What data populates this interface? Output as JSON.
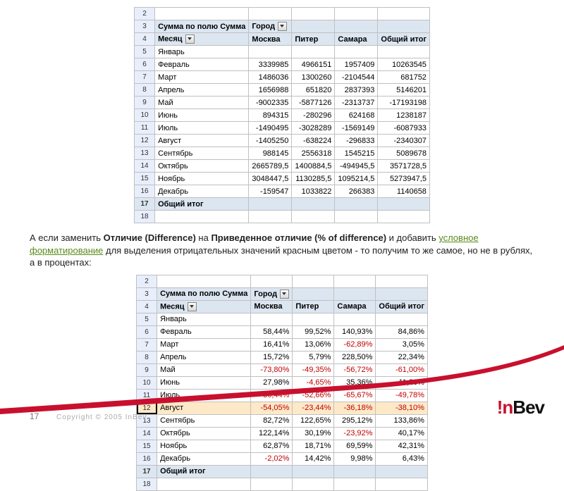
{
  "table1": {
    "pivot_label": "Сумма по полю Сумма",
    "col_group": "Город",
    "row_group": "Месяц",
    "columns": [
      "Москва",
      "Питер",
      "Самара",
      "Общий итог"
    ],
    "row_start_index": 2,
    "row_labels": [
      "Январь",
      "Февраль",
      "Март",
      "Апрель",
      "Май",
      "Июнь",
      "Июль",
      "Август",
      "Сентябрь",
      "Октябрь",
      "Ноябрь",
      "Декабрь"
    ],
    "total_label": "Общий итог",
    "data": [
      [
        "",
        "",
        "",
        ""
      ],
      [
        "3339985",
        "4966151",
        "1957409",
        "10263545"
      ],
      [
        "1486036",
        "1300260",
        "-2104544",
        "681752"
      ],
      [
        "1656988",
        "651820",
        "2837393",
        "5146201"
      ],
      [
        "-9002335",
        "-5877126",
        "-2313737",
        "-17193198"
      ],
      [
        "894315",
        "-280296",
        "624168",
        "1238187"
      ],
      [
        "-1490495",
        "-3028289",
        "-1569149",
        "-6087933"
      ],
      [
        "-1405250",
        "-638224",
        "-296833",
        "-2340307"
      ],
      [
        "988145",
        "2556318",
        "1545215",
        "5089678"
      ],
      [
        "2665789,5",
        "1400884,5",
        "-494945,5",
        "3571728,5"
      ],
      [
        "3048447,5",
        "1130285,5",
        "1095214,5",
        "5273947,5"
      ],
      [
        "-159547",
        "1033822",
        "266383",
        "1140658"
      ]
    ]
  },
  "paragraph": {
    "t1": "А если заменить ",
    "b1": "Отличие (Difference)",
    "t2": " на ",
    "b2": "Приведенное отличие (% of difference)",
    "t3": " и добавить ",
    "link": "условное форматирование",
    "t4": " для выделения отрицательных значений красным цветом - то получим то же самое, но не в рублях, а в процентах:"
  },
  "table2": {
    "pivot_label": "Сумма по полю Сумма",
    "col_group": "Город",
    "row_group": "Месяц",
    "columns": [
      "Москва",
      "Питер",
      "Самара",
      "Общий итог"
    ],
    "row_start_index": 2,
    "row_labels": [
      "Январь",
      "Февраль",
      "Март",
      "Апрель",
      "Май",
      "Июнь",
      "Июль",
      "Август",
      "Сентябрь",
      "Октябрь",
      "Ноябрь",
      "Декабрь"
    ],
    "total_label": "Общий итог",
    "selected_row_index": 7,
    "data": [
      [
        "",
        "",
        "",
        ""
      ],
      [
        "58,44%",
        "99,52%",
        "140,93%",
        "84,86%"
      ],
      [
        "16,41%",
        "13,06%",
        "-62,89%",
        "3,05%"
      ],
      [
        "15,72%",
        "5,79%",
        "228,50%",
        "22,34%"
      ],
      [
        "-73,80%",
        "-49,35%",
        "-56,72%",
        "-61,00%"
      ],
      [
        "27,98%",
        "-4,65%",
        "35,36%",
        "11,26%"
      ],
      [
        "-36,44%",
        "-52,66%",
        "-65,67%",
        "-49,78%"
      ],
      [
        "-54,05%",
        "-23,44%",
        "-36,18%",
        "-38,10%"
      ],
      [
        "82,72%",
        "122,65%",
        "295,12%",
        "133,86%"
      ],
      [
        "122,14%",
        "30,19%",
        "-23,92%",
        "40,17%"
      ],
      [
        "62,87%",
        "18,71%",
        "69,59%",
        "42,31%"
      ],
      [
        "-2,02%",
        "14,42%",
        "9,98%",
        "6,43%"
      ]
    ]
  },
  "footer": {
    "page": "17",
    "copyright": "Copyright © 2005 InBev",
    "logo_excl": "!",
    "logo_n": "n",
    "logo_rest": "Bev"
  }
}
